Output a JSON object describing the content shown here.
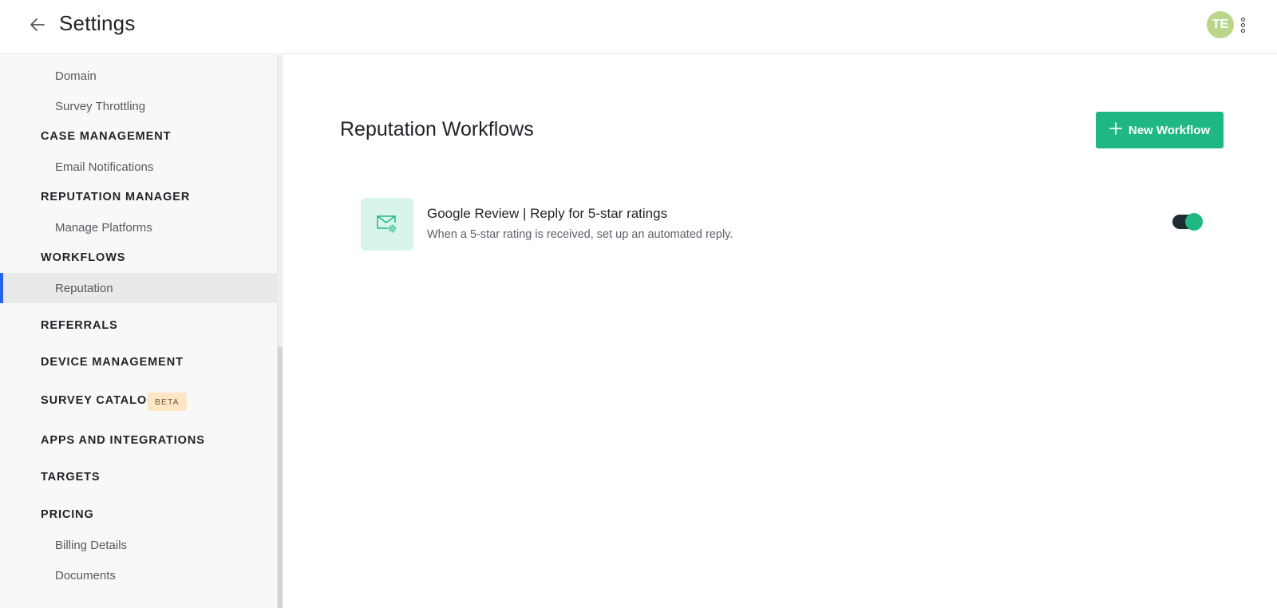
{
  "header": {
    "title": "Settings",
    "avatar_initials": "TE"
  },
  "sidebar": {
    "items": [
      {
        "label": "Domain",
        "kind": "sub"
      },
      {
        "label": "Survey Throttling",
        "kind": "sub"
      },
      {
        "label": "CASE MANAGEMENT",
        "kind": "section"
      },
      {
        "label": "Email Notifications",
        "kind": "sub"
      },
      {
        "label": "REPUTATION MANAGER",
        "kind": "section"
      },
      {
        "label": "Manage Platforms",
        "kind": "sub"
      },
      {
        "label": "WORKFLOWS",
        "kind": "section"
      },
      {
        "label": "Reputation",
        "kind": "sub",
        "active": true
      },
      {
        "label": "REFERRALS",
        "kind": "section"
      },
      {
        "label": "DEVICE MANAGEMENT",
        "kind": "section"
      },
      {
        "label": "SURVEY CATALOG",
        "kind": "section",
        "badge": "BETA"
      },
      {
        "label": "APPS AND INTEGRATIONS",
        "kind": "section"
      },
      {
        "label": "TARGETS",
        "kind": "section"
      },
      {
        "label": "PRICING",
        "kind": "section"
      },
      {
        "label": "Billing Details",
        "kind": "sub"
      },
      {
        "label": "Documents",
        "kind": "sub"
      }
    ]
  },
  "main": {
    "title": "Reputation Workflows",
    "new_button_label": "New Workflow",
    "workflows": [
      {
        "title": "Google Review | Reply for 5-star ratings",
        "description": "When a 5-star rating is received, set up an automated reply.",
        "icon": "email-settings-icon",
        "enabled": true
      }
    ]
  },
  "colors": {
    "accent_green": "#1fb784",
    "active_indicator": "#2563eb",
    "avatar_bg": "#b9d68a",
    "beta_badge_bg": "#fde6c4",
    "workflow_icon_bg": "#d9f4ea"
  }
}
